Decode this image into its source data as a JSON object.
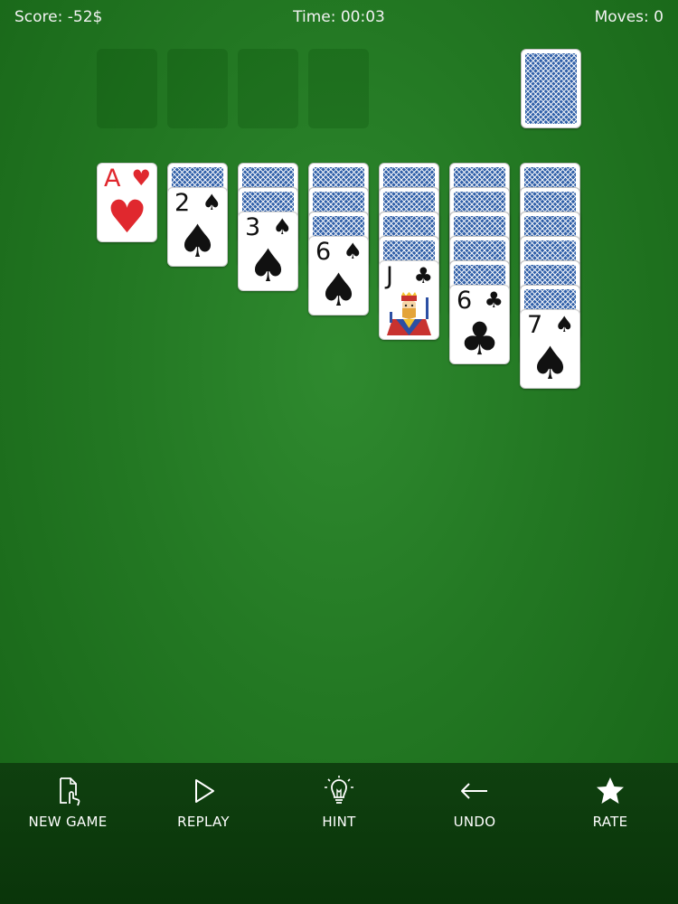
{
  "status": {
    "score": "Score: -52$",
    "time": "Time: 00:03",
    "moves": "Moves: 0"
  },
  "stock": {
    "face_down": true
  },
  "foundations": [
    {
      "empty": true
    },
    {
      "empty": true
    },
    {
      "empty": true
    },
    {
      "empty": true
    }
  ],
  "tableau": [
    {
      "hidden": 0,
      "top": {
        "rank": "A",
        "suit": "♥",
        "color": "red"
      }
    },
    {
      "hidden": 1,
      "top": {
        "rank": "2",
        "suit": "♠",
        "color": "black"
      }
    },
    {
      "hidden": 2,
      "top": {
        "rank": "3",
        "suit": "♠",
        "color": "black"
      }
    },
    {
      "hidden": 3,
      "top": {
        "rank": "6",
        "suit": "♠",
        "color": "black"
      }
    },
    {
      "hidden": 4,
      "top": {
        "rank": "J",
        "suit": "♣",
        "color": "black"
      }
    },
    {
      "hidden": 5,
      "top": {
        "rank": "6",
        "suit": "♣",
        "color": "black"
      }
    },
    {
      "hidden": 6,
      "top": {
        "rank": "7",
        "suit": "♠",
        "color": "black"
      }
    }
  ],
  "toolbar": {
    "new_game": "NEW GAME",
    "replay": "REPLAY",
    "hint": "HINT",
    "undo": "UNDO",
    "rate": "RATE"
  },
  "icons": {
    "new_game": "new-document-tap-icon",
    "replay": "play-triangle-icon",
    "hint": "lightbulb-icon",
    "undo": "arrow-left-icon",
    "rate": "star-icon"
  },
  "colors": {
    "felt": "#237823",
    "toolbar": "#0d3b0d",
    "card_back": "#2f5fa8",
    "red_suit": "#e0282e"
  }
}
